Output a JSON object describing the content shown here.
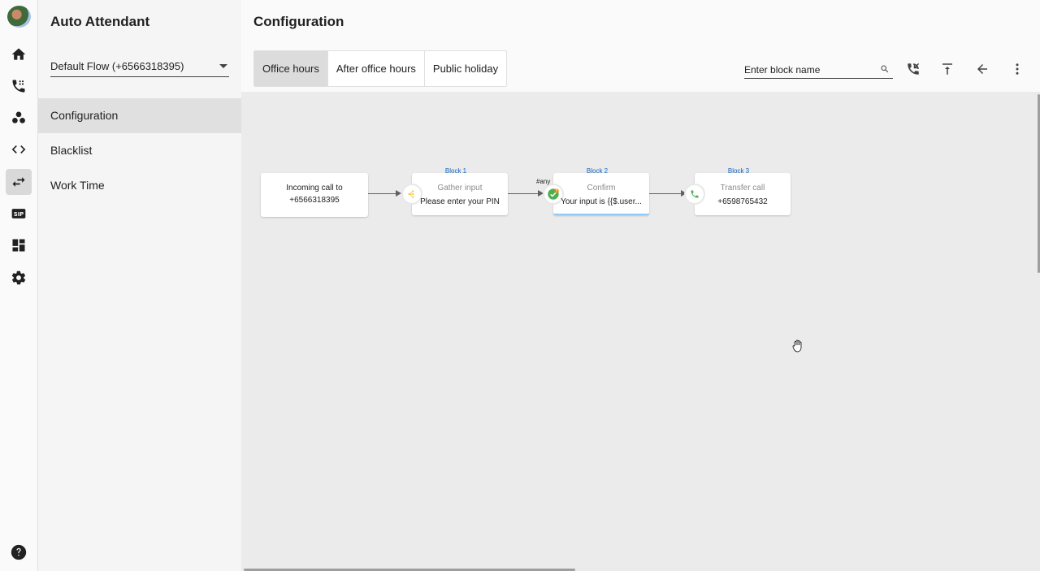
{
  "app": {
    "title": "Auto Attendant"
  },
  "rail": {
    "items": [
      {
        "icon": "home-icon"
      },
      {
        "icon": "call-flow-icon"
      },
      {
        "icon": "group-icon"
      },
      {
        "icon": "code-icon"
      },
      {
        "icon": "transfer-icon",
        "active": true
      },
      {
        "icon": "sip-icon",
        "text": "SIP"
      },
      {
        "icon": "dashboard-icon"
      },
      {
        "icon": "settings-icon"
      }
    ],
    "help_icon": "help-icon"
  },
  "sidebar": {
    "flow_select": {
      "value": "Default Flow (+6566318395)"
    },
    "items": [
      {
        "label": "Configuration",
        "active": true
      },
      {
        "label": "Blacklist"
      },
      {
        "label": "Work Time"
      }
    ]
  },
  "main": {
    "title": "Configuration",
    "tabs": [
      {
        "label": "Office hours",
        "active": true
      },
      {
        "label": "After office hours"
      },
      {
        "label": "Public holiday"
      }
    ],
    "search": {
      "placeholder": "Enter block name",
      "value": ""
    },
    "toolbar": [
      "incoming-call-icon",
      "move-to-top-icon",
      "back-arrow-icon",
      "more-vert-icon"
    ]
  },
  "flow": {
    "start_node": {
      "line1": "Incoming call to",
      "line2": "+6566318395"
    },
    "blocks": [
      {
        "label": "Block 1",
        "type": "Gather input",
        "desc": "Please enter your PIN",
        "icon": "gather-input-icon"
      },
      {
        "label": "Block 2",
        "type": "Confirm",
        "desc": "Your input is {{$.user...",
        "icon": "confirm-icon",
        "selected": true
      },
      {
        "label": "Block 3",
        "type": "Transfer call",
        "desc": "+6598765432",
        "icon": "phone-icon"
      }
    ],
    "edge_label": "#any"
  },
  "colors": {
    "canvas_bg": "#ebebeb",
    "accent_blue": "#1565c0",
    "confirm_green": "#4caf50",
    "gather_yellow": "#f9c74f"
  }
}
